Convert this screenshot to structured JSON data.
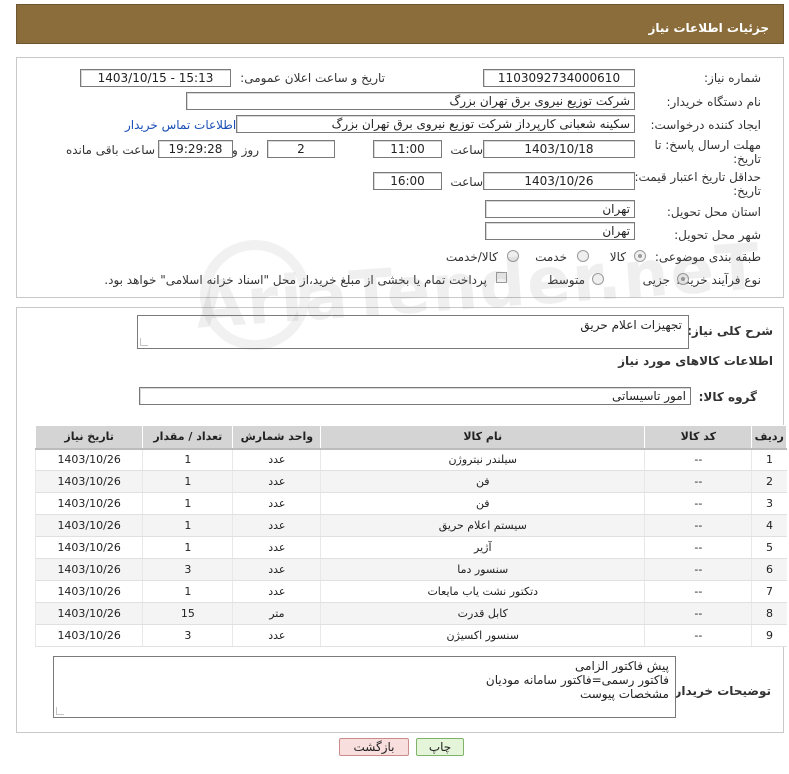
{
  "header": {
    "title": "جزئیات اطلاعات نیاز"
  },
  "form": {
    "need_number_label": "شماره نیاز:",
    "need_number_value": "1103092734000610",
    "announce_label": "تاریخ و ساعت اعلان عمومی:",
    "announce_value": "1403/10/15 - 15:13",
    "buyer_org_label": "نام دستگاه خریدار:",
    "buyer_org_value": "شرکت توزیع نیروی برق تهران بزرگ",
    "requester_label": "ایجاد کننده درخواست:",
    "requester_value": "سکینه شعبانی کارپرداز شرکت توزیع نیروی برق تهران بزرگ",
    "contact_link": "اطلاعات تماس خریدار",
    "reply_deadline_label_1": "مهلت ارسال پاسخ: تا",
    "reply_deadline_label_2": "تاریخ:",
    "reply_date": "1403/10/18",
    "time_label": "ساعت",
    "reply_time": "11:00",
    "days_value": "2",
    "days_label": "روز و",
    "remaining_time": "19:29:28",
    "remaining_label": "ساعت باقی مانده",
    "price_validity_label_1": "حداقل تاریخ اعتبار قیمت: تا",
    "price_validity_label_2": "تاریخ:",
    "price_date": "1403/10/26",
    "price_time": "16:00",
    "province_label": "استان محل تحویل:",
    "province_value": "تهران",
    "city_label": "شهر محل تحویل:",
    "city_value": "تهران",
    "category_label": "طبقه بندی موضوعی:",
    "category_options": [
      "کالا",
      "خدمت",
      "کالا/خدمت"
    ],
    "process_label": "نوع فرآیند خرید :",
    "process_options": [
      "جزیی",
      "متوسط"
    ],
    "payment_note": "پرداخت تمام یا بخشی از مبلغ خرید،از محل \"اسناد خزانه اسلامی\" خواهد بود."
  },
  "details": {
    "summary_label": "شرح کلی نیاز:",
    "summary_value": "تجهیزات اعلام حریق",
    "items_heading": "اطلاعات کالاهای مورد نیاز",
    "group_label": "گروه کالا:",
    "group_value": "امور تاسیساتی",
    "columns": [
      "ردیف",
      "کد کالا",
      "نام کالا",
      "واحد شمارش",
      "تعداد / مقدار",
      "تاریخ نیاز"
    ],
    "rows": [
      [
        "1",
        "--",
        "سیلندر نیتروژن",
        "عدد",
        "1",
        "1403/10/26"
      ],
      [
        "2",
        "--",
        "فن",
        "عدد",
        "1",
        "1403/10/26"
      ],
      [
        "3",
        "--",
        "فن",
        "عدد",
        "1",
        "1403/10/26"
      ],
      [
        "4",
        "--",
        "سیستم اعلام حریق",
        "عدد",
        "1",
        "1403/10/26"
      ],
      [
        "5",
        "--",
        "آژیر",
        "عدد",
        "1",
        "1403/10/26"
      ],
      [
        "6",
        "--",
        "سنسور دما",
        "عدد",
        "3",
        "1403/10/26"
      ],
      [
        "7",
        "--",
        "دتکتور نشت یاب مایعات",
        "عدد",
        "1",
        "1403/10/26"
      ],
      [
        "8",
        "--",
        "کابل قدرت",
        "متر",
        "15",
        "1403/10/26"
      ],
      [
        "9",
        "--",
        "سنسور اکسیژن",
        "عدد",
        "3",
        "1403/10/26"
      ]
    ],
    "buyer_notes_label": "توضیحات خریدار:",
    "buyer_notes_lines": [
      "پیش فاکتور الزامی",
      "فاکتور رسمی=فاکتور سامانه مودیان",
      "مشخصات پیوست"
    ]
  },
  "buttons": {
    "print": "چاپ",
    "back": "بازگشت"
  },
  "watermark": "AriaTender.neT"
}
